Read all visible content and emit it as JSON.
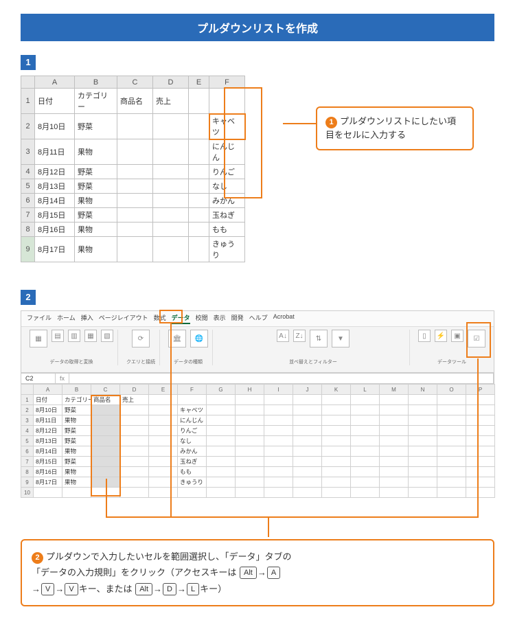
{
  "title": "プルダウンリストを作成",
  "step1_badge": "1",
  "step2_badge": "2",
  "table1": {
    "cols": [
      "A",
      "B",
      "C",
      "D",
      "E",
      "F"
    ],
    "headers": {
      "A": "日付",
      "B": "カテゴリー",
      "C": "商品名",
      "D": "売上"
    },
    "rows": [
      {
        "n": "1"
      },
      {
        "n": "2",
        "A": "8月10日",
        "B": "野菜",
        "F": "キャベツ"
      },
      {
        "n": "3",
        "A": "8月11日",
        "B": "果物",
        "F": "にんじん"
      },
      {
        "n": "4",
        "A": "8月12日",
        "B": "野菜",
        "F": "りんご"
      },
      {
        "n": "5",
        "A": "8月13日",
        "B": "野菜",
        "F": "なし"
      },
      {
        "n": "6",
        "A": "8月14日",
        "B": "果物",
        "F": "みかん"
      },
      {
        "n": "7",
        "A": "8月15日",
        "B": "野菜",
        "F": "玉ねぎ"
      },
      {
        "n": "8",
        "A": "8月16日",
        "B": "果物",
        "F": "もも"
      },
      {
        "n": "9",
        "A": "8月17日",
        "B": "果物",
        "F": "きゅうり"
      }
    ]
  },
  "callout1": {
    "num": "1",
    "text": "プルダウンリストにしたい項目をセルに入力する"
  },
  "ribbon": {
    "tabs": [
      "ファイル",
      "ホーム",
      "挿入",
      "ページレイアウト",
      "数式",
      "データ",
      "校閲",
      "表示",
      "開発",
      "ヘルプ",
      "Acrobat"
    ],
    "active_tab": "データ",
    "groups": {
      "g1": "データの取得と変換",
      "g2": "クエリと接続",
      "g3": "データの種類",
      "g4": "並べ替えとフィルター",
      "g5": "データツール"
    },
    "btn_validation": "データの入力規則"
  },
  "formula_bar": {
    "ref": "C2",
    "fx": "fx"
  },
  "table2": {
    "cols": [
      "A",
      "B",
      "C",
      "D",
      "E",
      "F",
      "G",
      "H",
      "I",
      "J",
      "K",
      "L",
      "M",
      "N",
      "O",
      "P"
    ],
    "headers": {
      "A": "日付",
      "B": "カテゴリー",
      "C": "商品名",
      "D": "売上"
    },
    "rows": [
      {
        "n": "1"
      },
      {
        "n": "2",
        "A": "8月10日",
        "B": "野菜",
        "F": "キャベツ"
      },
      {
        "n": "3",
        "A": "8月11日",
        "B": "果物",
        "F": "にんじん"
      },
      {
        "n": "4",
        "A": "8月12日",
        "B": "野菜",
        "F": "りんご"
      },
      {
        "n": "5",
        "A": "8月13日",
        "B": "野菜",
        "F": "なし"
      },
      {
        "n": "6",
        "A": "8月14日",
        "B": "果物",
        "F": "みかん"
      },
      {
        "n": "7",
        "A": "8月15日",
        "B": "野菜",
        "F": "玉ねぎ"
      },
      {
        "n": "8",
        "A": "8月16日",
        "B": "果物",
        "F": "もも"
      },
      {
        "n": "9",
        "A": "8月17日",
        "B": "果物",
        "F": "きゅうり"
      },
      {
        "n": "10"
      }
    ]
  },
  "callout2": {
    "num": "2",
    "line1a": "プルダウンで入力したいセルを範囲選択し、「データ」タブの",
    "line2a": "「データの入力規則」をクリック（アクセスキーは",
    "k_alt": "Alt",
    "k_a": "A",
    "k_v": "V",
    "k_d": "D",
    "k_l": "L",
    "arrow": "→",
    "line3a": "キー、または",
    "line3b": "キー）"
  }
}
